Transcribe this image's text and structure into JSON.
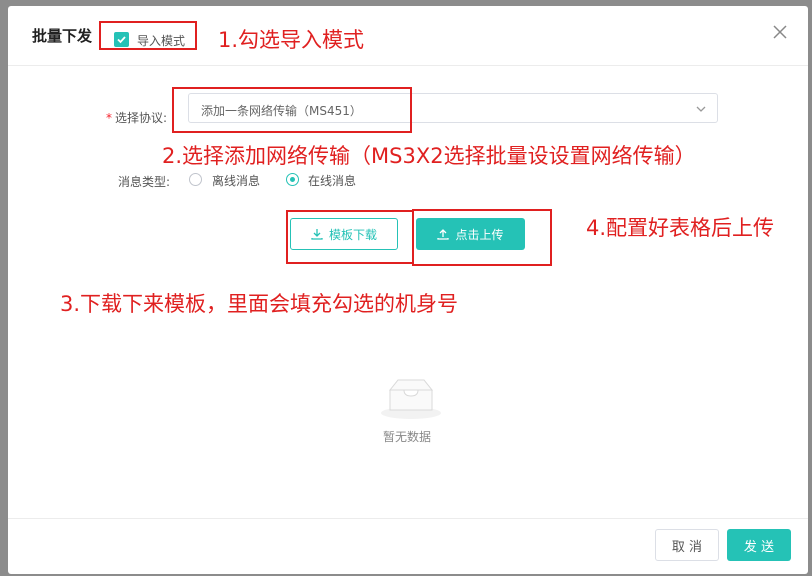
{
  "header": {
    "title": "批量下发",
    "import_mode_label": "导入模式",
    "import_mode_checked": true,
    "close_icon": "close-icon"
  },
  "form": {
    "protocol_label": "选择协议",
    "protocol_value": "添加一条网络传输（MS451）",
    "message_type_label": "消息类型",
    "options": [
      {
        "label": "离线消息",
        "selected": false
      },
      {
        "label": "在线消息",
        "selected": true
      }
    ]
  },
  "actions": {
    "template_download": "模板下载",
    "click_upload": "点击上传"
  },
  "empty": {
    "text": "暂无数据"
  },
  "footer": {
    "cancel": "取 消",
    "send": "发 送"
  },
  "annotations": {
    "step1": "1.勾选导入模式",
    "step2": "2.选择添加网络传输（MS3X2选择批量设设置网络传输）",
    "step3": "3.下载下来模板，里面会填充勾选的机身号",
    "step4": "4.配置好表格后上传"
  },
  "colors": {
    "accent": "#25c2b6",
    "annotation": "#e02020"
  }
}
